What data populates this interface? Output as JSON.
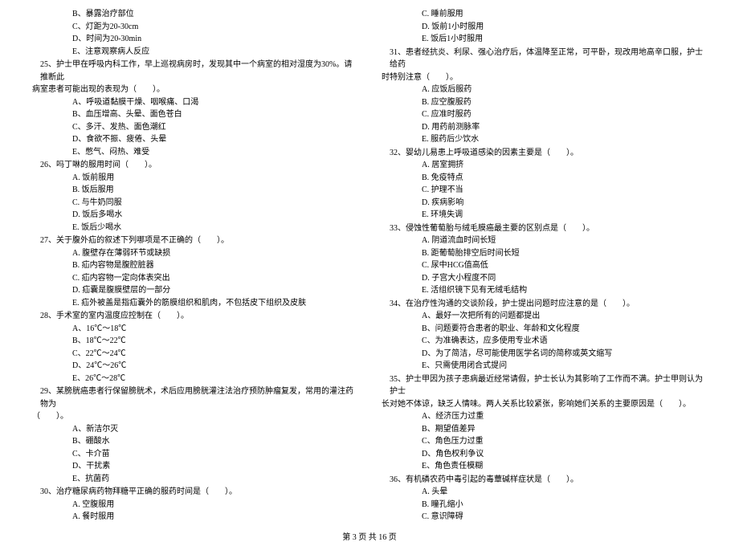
{
  "left_col": [
    {
      "type": "option",
      "text": "B、暴露治疗部位"
    },
    {
      "type": "option",
      "text": "C、灯距为20-30cm"
    },
    {
      "type": "option",
      "text": "D、时间为20-30min"
    },
    {
      "type": "option",
      "text": "E、注意观察病人反应"
    },
    {
      "type": "question",
      "text": "25、护士甲在呼吸内科工作，早上巡视病房时，发现其中一个病室的相对湿度为30%。请推断此"
    },
    {
      "type": "question-cont",
      "text": "病室患者可能出现的表现为（　　）。"
    },
    {
      "type": "option",
      "text": "A、呼吸道黏膜干燥、咽喉痛、口渴"
    },
    {
      "type": "option",
      "text": "B、血压增高、头晕、面色苍白"
    },
    {
      "type": "option",
      "text": "C、多汗、发热、面色潮红"
    },
    {
      "type": "option",
      "text": "D、食欲不振、疲倦、头晕"
    },
    {
      "type": "option",
      "text": "E、憋气、闷热、难受"
    },
    {
      "type": "question",
      "text": "26、吗丁啉的服用时间（　　）。"
    },
    {
      "type": "option",
      "text": "A. 饭前服用"
    },
    {
      "type": "option",
      "text": "B. 饭后服用"
    },
    {
      "type": "option",
      "text": "C. 与牛奶同服"
    },
    {
      "type": "option",
      "text": "D. 饭后多喝水"
    },
    {
      "type": "option",
      "text": "E. 饭后少喝水"
    },
    {
      "type": "question",
      "text": "27、关于腹外疝的叙述下列哪项是不正确的（　　）。"
    },
    {
      "type": "option",
      "text": "A. 腹壁存在薄弱环节或缺损"
    },
    {
      "type": "option",
      "text": "B. 疝内容物是腹腔脏器"
    },
    {
      "type": "option",
      "text": "C. 疝内容物一定向体表突出"
    },
    {
      "type": "option",
      "text": "D. 疝囊是腹膜壁层的一部分"
    },
    {
      "type": "option",
      "text": "E. 疝外被盖是指疝囊外的筋膜组织和肌肉，不包括皮下组织及皮肤"
    },
    {
      "type": "question",
      "text": "28、手术室的室内温度应控制在（　　）。"
    },
    {
      "type": "option",
      "text": "A、16℃～18℃"
    },
    {
      "type": "option",
      "text": "B、18℃～22℃"
    },
    {
      "type": "option",
      "text": "C、22℃～24℃"
    },
    {
      "type": "option",
      "text": "D、24℃～26℃"
    },
    {
      "type": "option",
      "text": "E、26℃～28℃"
    },
    {
      "type": "question",
      "text": "29、某膀胱癌患者行保留膀胱术，术后应用膀胱灌注法治疗预防肿瘤复发，常用的灌注药物为"
    },
    {
      "type": "question-cont",
      "text": "（　　）。"
    },
    {
      "type": "option",
      "text": "A、新洁尔灭"
    },
    {
      "type": "option",
      "text": "B、硼酸水"
    },
    {
      "type": "option",
      "text": "C、卡介苗"
    },
    {
      "type": "option",
      "text": "D、干扰素"
    },
    {
      "type": "option",
      "text": "E、抗菌药"
    },
    {
      "type": "question",
      "text": "30、治疗糖尿病药物拜糖平正确的服药时间是（　　）。"
    },
    {
      "type": "option",
      "text": "A. 空腹服用"
    },
    {
      "type": "option",
      "text": "A. 餐时服用"
    }
  ],
  "right_col": [
    {
      "type": "option",
      "text": "C. 睡前服用"
    },
    {
      "type": "option",
      "text": "D. 饭前1小时服用"
    },
    {
      "type": "option",
      "text": "E. 饭后1小时服用"
    },
    {
      "type": "question",
      "text": "31、患者经抗炎、利尿、强心治疗后，体温降至正常，可平卧，现改用地高辛口服，护士给药"
    },
    {
      "type": "question-cont",
      "text": "时特别注意（　　）。"
    },
    {
      "type": "option",
      "text": "A. 应饭后服药"
    },
    {
      "type": "option",
      "text": "B. 应空腹服药"
    },
    {
      "type": "option",
      "text": "C. 应准时服药"
    },
    {
      "type": "option",
      "text": "D. 用药前测脉率"
    },
    {
      "type": "option",
      "text": "E. 服药后少饮水"
    },
    {
      "type": "question",
      "text": "32、婴幼儿易患上呼吸道感染的因素主要是（　　）。"
    },
    {
      "type": "option",
      "text": "A. 居室拥挤"
    },
    {
      "type": "option",
      "text": "B. 免疫特点"
    },
    {
      "type": "option",
      "text": "C. 护理不当"
    },
    {
      "type": "option",
      "text": "D. 疾病影响"
    },
    {
      "type": "option",
      "text": "E. 环境失调"
    },
    {
      "type": "question",
      "text": "33、侵蚀性葡萄胎与绒毛膜癌最主要的区别点是（　　）。"
    },
    {
      "type": "option",
      "text": "A. 阴道流血时间长短"
    },
    {
      "type": "option",
      "text": "B. 距葡萄胎排空后时间长短"
    },
    {
      "type": "option",
      "text": "C. 尿中HCG值高低"
    },
    {
      "type": "option",
      "text": "D. 子宫大小程度不同"
    },
    {
      "type": "option",
      "text": "E. 活组织镜下见有无绒毛结构"
    },
    {
      "type": "question",
      "text": "34、在治疗性沟通的交谈阶段，护士提出问题时应注意的是（　　）。"
    },
    {
      "type": "option",
      "text": "A、最好一次把所有的问题都提出"
    },
    {
      "type": "option",
      "text": "B、问题要符合患者的职业、年龄和文化程度"
    },
    {
      "type": "option",
      "text": "C、为准确表达，应多使用专业术语"
    },
    {
      "type": "option",
      "text": "D、为了简洁，尽可能使用医学名词的简称或英文缩写"
    },
    {
      "type": "option",
      "text": "E、只需使用闭合式提问"
    },
    {
      "type": "question",
      "text": "35、护士甲因为孩子患病最近经常请假，护士长认为其影响了工作而不满。护士甲则认为护士"
    },
    {
      "type": "question-cont",
      "text": "长对她不体谅，缺乏人情味。两人关系比较紧张，影响她们关系的主要原因是（　　）。"
    },
    {
      "type": "option",
      "text": "A、经济压力过重"
    },
    {
      "type": "option",
      "text": "B、期望值差异"
    },
    {
      "type": "option",
      "text": "C、角色压力过重"
    },
    {
      "type": "option",
      "text": "D、角色权利争议"
    },
    {
      "type": "option",
      "text": "E、角色责任模糊"
    },
    {
      "type": "question",
      "text": "36、有机磷农药中毒引起的毒蕈碱样症状是（　　）。"
    },
    {
      "type": "option",
      "text": "A. 头晕"
    },
    {
      "type": "option",
      "text": "B. 瞳孔缩小"
    },
    {
      "type": "option",
      "text": "C. 意识障碍"
    }
  ],
  "footer": "第 3 页 共 16 页"
}
